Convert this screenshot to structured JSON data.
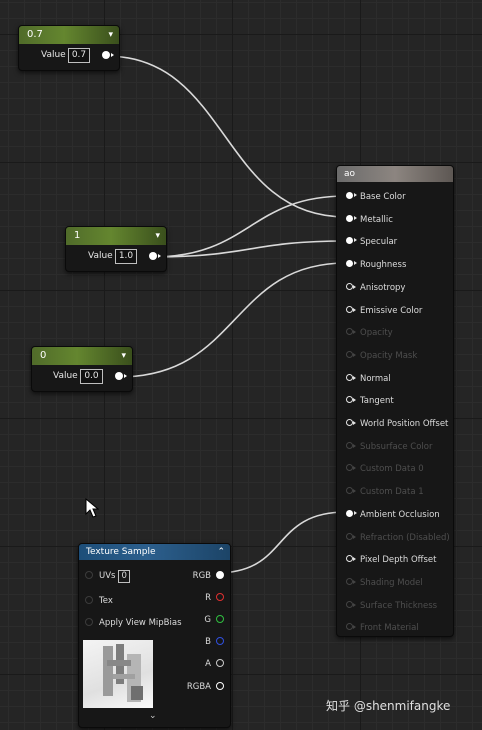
{
  "nodes": {
    "const_07": {
      "title": "0.7",
      "value_label": "Value",
      "value": "0.7"
    },
    "const_1": {
      "title": "1",
      "value_label": "Value",
      "value": "1.0"
    },
    "const_0": {
      "title": "0",
      "value_label": "Value",
      "value": "0.0"
    }
  },
  "material": {
    "title": "ao",
    "inputs": [
      {
        "label": "Base Color",
        "state": "connected"
      },
      {
        "label": "Metallic",
        "state": "connected"
      },
      {
        "label": "Specular",
        "state": "connected"
      },
      {
        "label": "Roughness",
        "state": "connected"
      },
      {
        "label": "Anisotropy",
        "state": "enabled"
      },
      {
        "label": "Emissive Color",
        "state": "enabled"
      },
      {
        "label": "Opacity",
        "state": "disabled"
      },
      {
        "label": "Opacity Mask",
        "state": "disabled"
      },
      {
        "label": "Normal",
        "state": "enabled"
      },
      {
        "label": "Tangent",
        "state": "enabled"
      },
      {
        "label": "World Position Offset",
        "state": "enabled"
      },
      {
        "label": "Subsurface Color",
        "state": "disabled"
      },
      {
        "label": "Custom Data 0",
        "state": "disabled"
      },
      {
        "label": "Custom Data 1",
        "state": "disabled"
      },
      {
        "label": "Ambient Occlusion",
        "state": "connected"
      },
      {
        "label": "Refraction (Disabled)",
        "state": "disabled"
      },
      {
        "label": "Pixel Depth Offset",
        "state": "enabled"
      },
      {
        "label": "Shading Model",
        "state": "disabled"
      },
      {
        "label": "Surface Thickness",
        "state": "disabled"
      },
      {
        "label": "Front Material",
        "state": "disabled"
      }
    ]
  },
  "texture_sample": {
    "title": "Texture Sample",
    "uvs_label": "UVs",
    "uvs_value": "0",
    "tex_label": "Tex",
    "mip_label": "Apply View MipBias",
    "outputs": [
      {
        "label": "RGB",
        "color": "#ffffff"
      },
      {
        "label": "R",
        "color": "#e03030"
      },
      {
        "label": "G",
        "color": "#30c040"
      },
      {
        "label": "B",
        "color": "#3050e0"
      },
      {
        "label": "A",
        "color": "#cccccc"
      },
      {
        "label": "RGBA",
        "color": "#ffffff"
      }
    ]
  },
  "watermark": "知乎 @shenmifangke",
  "icons": {
    "collapse": "chevron-down-icon",
    "cursor": "mouse-pointer-icon"
  },
  "colors": {
    "constant_header": "#5f7f2e",
    "texture_header": "#28588a",
    "wire": "#dcdcdc",
    "grid_bg": "#252525"
  }
}
